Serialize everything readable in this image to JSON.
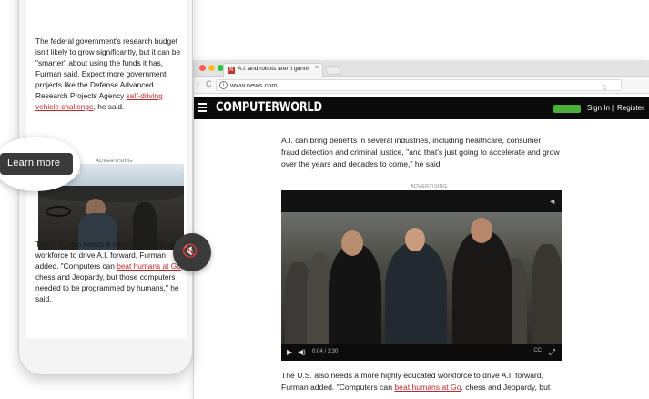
{
  "browser": {
    "tab_title": "A.I. and robots aren't gunning",
    "tab_favicon": "N",
    "tab_close": "×",
    "url": "www.news.com",
    "nav_back": "‹",
    "nav_reload": "C",
    "info_glyph": "i",
    "star_glyph": "☆"
  },
  "site": {
    "logo": "COMPUTERWORLD",
    "sign_in": "Sign In",
    "separator": "|",
    "register": "Register",
    "accent_color": "#4caf3a"
  },
  "desktop_article": {
    "paragraph1": "A.I. can bring benefits in several industries, including healthcare, consumer fraud detection and criminal justice, \"and that's just going to accelerate and grow over the years and decades to come,\" he said.",
    "ad_label": "ADVERTISING",
    "p2_before": "The U.S. also needs a more highly educated workforce to drive A.I. forward, Furman added. \"Computers can ",
    "p2_link": "beat humans at Go",
    "p2_after": ", chess and Jeopardy, but"
  },
  "desktop_video": {
    "time": "0:04 / 1:30",
    "play_icon": "▶",
    "volume_icon": "◀)",
    "share_icon": "◄",
    "cc": "CC",
    "fullscreen_icon": "⤢"
  },
  "mobile_article": {
    "p1_before": "The federal government's research budget isn't likely to grow significantly, but it can be \"smarter\" about using the funds it has, Furman said. Expect more government projects like the Defense Advanced Research Projects Agency ",
    "p1_link": "self-driving vehicle challenge",
    "p1_after": ", he said.",
    "ad_label": "ADVERTISING",
    "p2_before": "The U.S. also needs a more highly educated workforce to drive A.I. forward, Furman added. \"Computers can ",
    "p2_link": "beat humans at Go",
    "p2_after": ", chess and Jeopardy, but those computers needed to be programmed by humans,\" he said."
  },
  "mobile_ad": {
    "learn_more": "Learn more",
    "small_more": "ore",
    "close": "×",
    "mute_glyph": "🔇"
  }
}
